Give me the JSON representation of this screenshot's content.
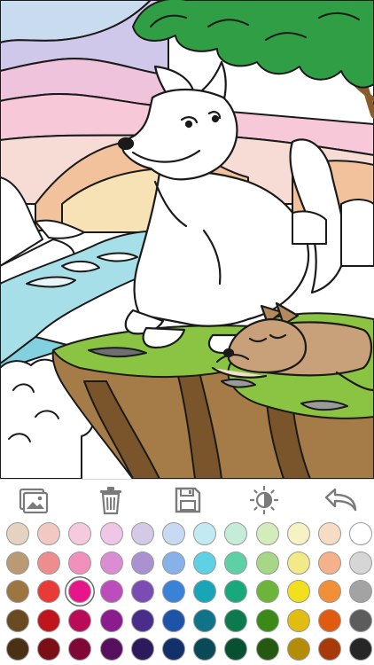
{
  "app": {
    "canvas_subject": "wolves-on-cliff-coloring-page"
  },
  "toolbar": {
    "buttons": [
      {
        "name": "gallery-button",
        "icon": "picture-icon"
      },
      {
        "name": "clear-button",
        "icon": "trash-icon"
      },
      {
        "name": "save-button",
        "icon": "floppy-disk-icon"
      },
      {
        "name": "brightness-button",
        "icon": "half-sun-icon"
      },
      {
        "name": "undo-button",
        "icon": "undo-arrow-icon"
      }
    ]
  },
  "palette": {
    "selected_index": 26,
    "rows": [
      [
        "#e6d2c0",
        "#f2c8c2",
        "#f6cade",
        "#efc6e6",
        "#d4cae6",
        "#c8daf1",
        "#c2eaf2",
        "#c4ecd8",
        "#d4ecbc",
        "#f6f2c4",
        "#f6dcc4",
        "#ffffff"
      ],
      [
        "#b99a74",
        "#ee8d8d",
        "#f191bb",
        "#db8cd2",
        "#a992cf",
        "#87b2e9",
        "#5ed2e4",
        "#5dd0a6",
        "#a6d686",
        "#f2ea88",
        "#f4b18a",
        "#d6d6d6"
      ],
      [
        "#9c7640",
        "#e83a36",
        "#e6168a",
        "#bb4dbd",
        "#7a4cb4",
        "#3a82d8",
        "#19a5b8",
        "#18a87c",
        "#6db43a",
        "#f2df1e",
        "#f29038",
        "#a3a3a3"
      ],
      [
        "#6a4a22",
        "#c0151c",
        "#b80c58",
        "#8a1c8e",
        "#4a2c8a",
        "#1e54a8",
        "#107488",
        "#0d7a4e",
        "#3a8a18",
        "#e2bc10",
        "#e05a10",
        "#5c5c5c"
      ],
      [
        "#4a3014",
        "#7a1016",
        "#800838",
        "#58105e",
        "#2c1a5c",
        "#12306a",
        "#0a4a58",
        "#085032",
        "#245a10",
        "#b48c08",
        "#a83a0a",
        "#262626"
      ]
    ]
  }
}
